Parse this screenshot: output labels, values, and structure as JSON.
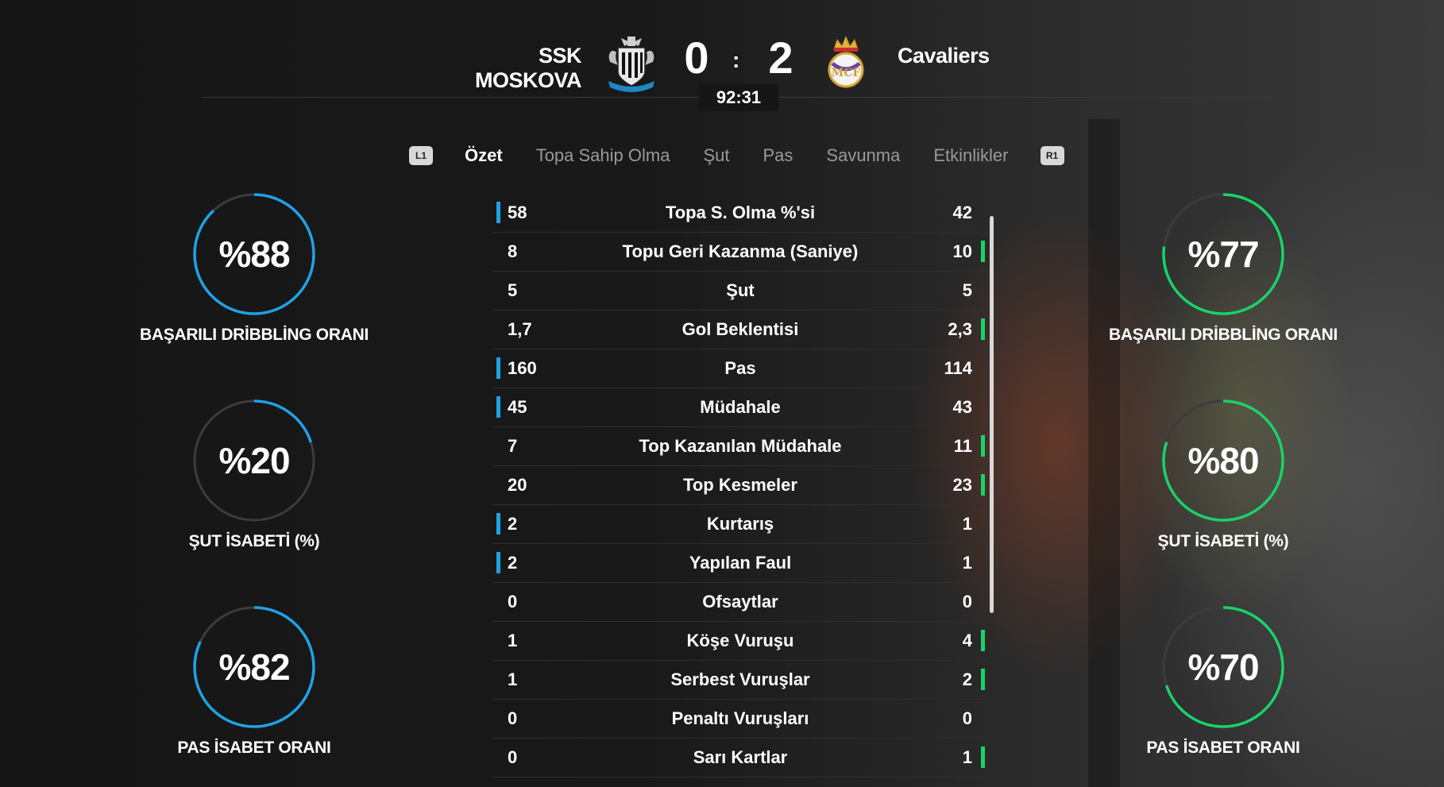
{
  "header": {
    "home_team": "SSK MOSKOVA",
    "away_team": "Cavaliers",
    "home_score": "0",
    "away_score": "2",
    "separator": ":",
    "clock": "92:31",
    "home_crest_icon": "newcastle-crest-icon",
    "away_crest_icon": "real-madrid-crest-icon"
  },
  "tabs": {
    "left_button": "L1",
    "right_button": "R1",
    "items": [
      "Özet",
      "Topa Sahip Olma",
      "Şut",
      "Pas",
      "Savunma",
      "Etkinlikler"
    ],
    "active": "Özet"
  },
  "colors": {
    "home_accent": "#1fa2e6",
    "away_accent": "#17d46a",
    "track": "#3c3c3c"
  },
  "home_rings": [
    {
      "value": "%88",
      "percent": 88,
      "label": "BAŞARILI DRİBBLİNG ORANI"
    },
    {
      "value": "%20",
      "percent": 20,
      "label": "ŞUT İSABETİ (%)"
    },
    {
      "value": "%82",
      "percent": 82,
      "label": "PAS İSABET ORANI"
    }
  ],
  "away_rings": [
    {
      "value": "%77",
      "percent": 77,
      "label": "BAŞARILI DRİBBLİNG ORANI"
    },
    {
      "value": "%80",
      "percent": 80,
      "label": "ŞUT İSABETİ (%)"
    },
    {
      "value": "%70",
      "percent": 70,
      "label": "PAS İSABET ORANI"
    }
  ],
  "stats": [
    {
      "home": "58",
      "label": "Topa S. Olma %'si",
      "away": "42",
      "leader": "home"
    },
    {
      "home": "8",
      "label": "Topu Geri Kazanma (Saniye)",
      "away": "10",
      "leader": "away"
    },
    {
      "home": "5",
      "label": "Şut",
      "away": "5",
      "leader": "none"
    },
    {
      "home": "1,7",
      "label": "Gol Beklentisi",
      "away": "2,3",
      "leader": "away"
    },
    {
      "home": "160",
      "label": "Pas",
      "away": "114",
      "leader": "home"
    },
    {
      "home": "45",
      "label": "Müdahale",
      "away": "43",
      "leader": "home"
    },
    {
      "home": "7",
      "label": "Top Kazanılan Müdahale",
      "away": "11",
      "leader": "away"
    },
    {
      "home": "20",
      "label": "Top Kesmeler",
      "away": "23",
      "leader": "away"
    },
    {
      "home": "2",
      "label": "Kurtarış",
      "away": "1",
      "leader": "home"
    },
    {
      "home": "2",
      "label": "Yapılan Faul",
      "away": "1",
      "leader": "home"
    },
    {
      "home": "0",
      "label": "Ofsaytlar",
      "away": "0",
      "leader": "none"
    },
    {
      "home": "1",
      "label": "Köşe Vuruşu",
      "away": "4",
      "leader": "away"
    },
    {
      "home": "1",
      "label": "Serbest Vuruşlar",
      "away": "2",
      "leader": "away"
    },
    {
      "home": "0",
      "label": "Penaltı Vuruşları",
      "away": "0",
      "leader": "none"
    },
    {
      "home": "0",
      "label": "Sarı Kartlar",
      "away": "1",
      "leader": "away"
    }
  ]
}
